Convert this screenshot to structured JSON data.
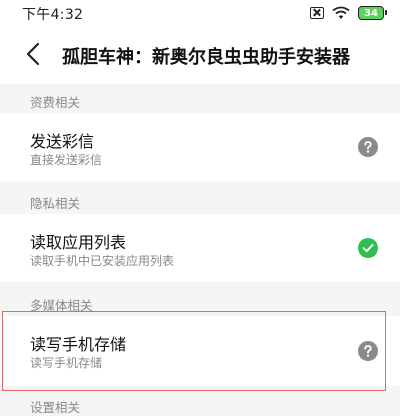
{
  "status_bar": {
    "time": "下午4:32",
    "battery": "34"
  },
  "header": {
    "title": "孤胆车神：新奥尔良虫虫助手安装器"
  },
  "sections": [
    {
      "label": "资费相关",
      "item": {
        "title": "发送彩信",
        "subtitle": "直接发送彩信",
        "status": "unknown"
      }
    },
    {
      "label": "隐私相关",
      "item": {
        "title": "读取应用列表",
        "subtitle": "读取手机中已安装应用列表",
        "status": "allowed"
      }
    },
    {
      "label": "多媒体相关",
      "item": {
        "title": "读写手机存储",
        "subtitle": "读写手机存储",
        "status": "unknown"
      }
    },
    {
      "label": "设置相关"
    }
  ],
  "colors": {
    "allowed": "#2fbf4f",
    "unknown": "#8a8a8a",
    "highlight": "#e06a6a"
  }
}
